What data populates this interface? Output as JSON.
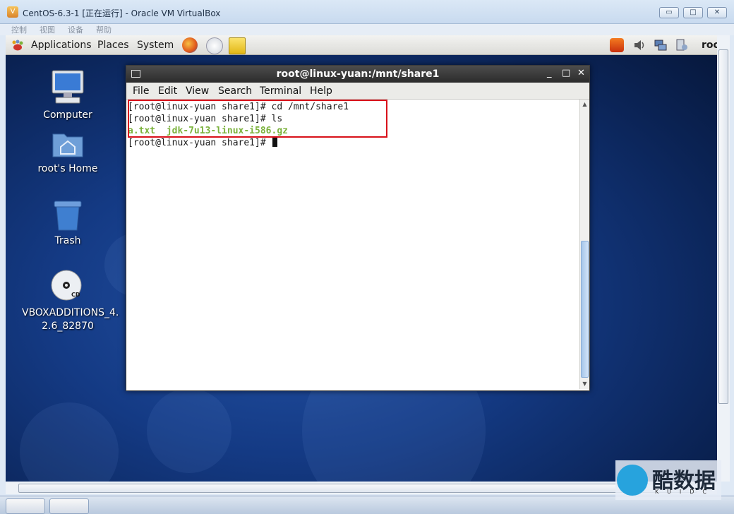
{
  "host_window": {
    "title": "CentOS-6.3-1 [正在运行] - Oracle VM VirtualBox",
    "minimize": "▭",
    "maximize": "□",
    "close": "✕",
    "menu": [
      "控制",
      "视图",
      "设备",
      "帮助"
    ]
  },
  "gnome_panel": {
    "menus": [
      "Applications",
      "Places",
      "System"
    ],
    "user": "roo"
  },
  "desktop_icons": [
    {
      "label_line1": "Computer",
      "label_line2": ""
    },
    {
      "label_line1": "root's Home",
      "label_line2": ""
    },
    {
      "label_line1": "Trash",
      "label_line2": ""
    },
    {
      "label_line1": "VBOXADDITIONS_4.",
      "label_line2": "2.6_82870",
      "badge": "CD"
    }
  ],
  "terminal": {
    "title": "root@linux-yuan:/mnt/share1",
    "controls": [
      "_",
      "□",
      "✕"
    ],
    "menu": [
      "File",
      "Edit",
      "View",
      "Search",
      "Terminal",
      "Help"
    ],
    "lines": [
      "[root@linux-yuan share1]# cd /mnt/share1",
      "[root@linux-yuan share1]# ls",
      "a.txt  jdk-7u13-linux-i586.gz",
      "[root@linux-yuan share1]# "
    ]
  },
  "watermark": {
    "text": "酷数据",
    "sub": "KUIDC"
  },
  "colors": {
    "ls_output": "#7bb23c",
    "highlight_box": "#d8111a",
    "terminal_titlebar": "#2b2b2b"
  }
}
